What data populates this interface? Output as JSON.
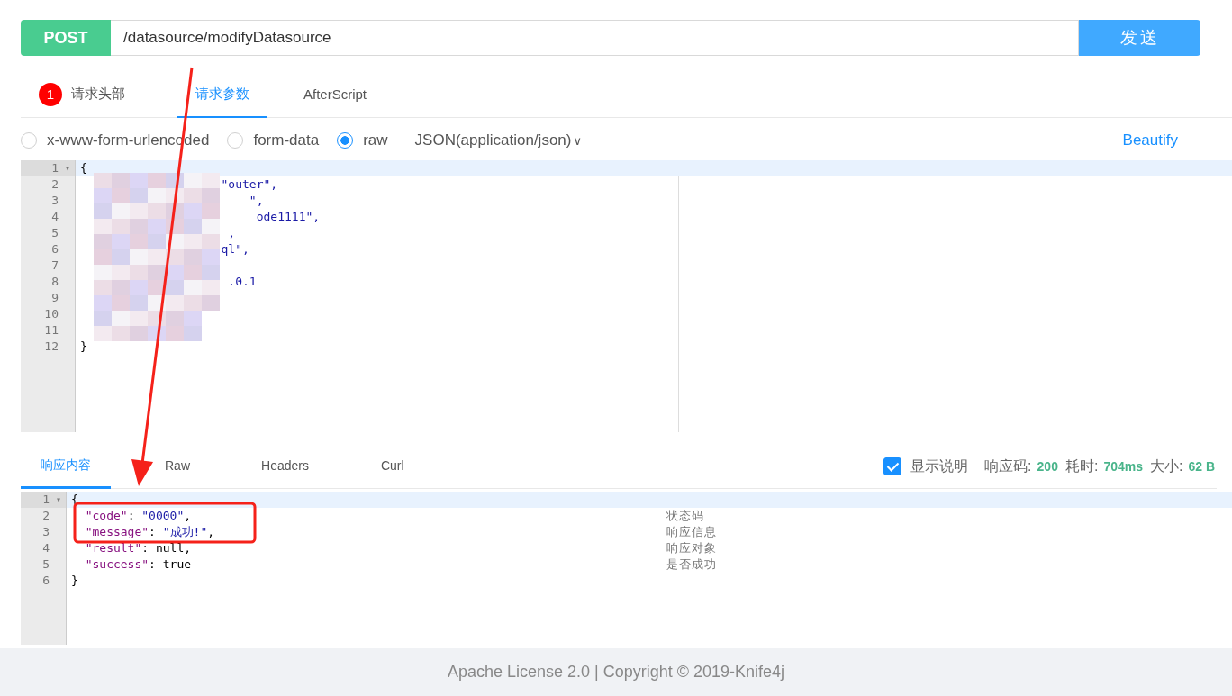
{
  "request": {
    "method": "POST",
    "url": "/datasource/modifyDatasource",
    "send": "发送"
  },
  "tabs": [
    {
      "label": "请求头部",
      "badge": "1",
      "selected": false
    },
    {
      "label": "请求参数",
      "selected": true
    },
    {
      "label": "AfterScript",
      "selected": false
    }
  ],
  "body_types": [
    {
      "label": "x-www-form-urlencoded",
      "selected": false
    },
    {
      "label": "form-data",
      "selected": false
    },
    {
      "label": "raw",
      "selected": true
    }
  ],
  "content_type": "JSON(application/json)",
  "caret": "∨",
  "beautify": "Beautify",
  "request_editor": {
    "lines": [
      {
        "no": "1",
        "text": "{",
        "fold": "▾"
      },
      {
        "no": "2",
        "text": "                    \"outer\","
      },
      {
        "no": "3",
        "text": "                        \","
      },
      {
        "no": "4",
        "text": "                         ode1111\","
      },
      {
        "no": "5",
        "text": "                     ,"
      },
      {
        "no": "6",
        "text": "                    ql\","
      },
      {
        "no": "7"
      },
      {
        "no": "8",
        "text": "                     .0.1"
      },
      {
        "no": "9"
      },
      {
        "no": "10"
      },
      {
        "no": "11"
      },
      {
        "no": "12",
        "text": "}"
      }
    ]
  },
  "response_tabs": [
    {
      "label": "响应内容",
      "selected": true
    },
    {
      "label": "Raw",
      "selected": false
    },
    {
      "label": "Headers",
      "selected": false
    },
    {
      "label": "Curl",
      "selected": false
    }
  ],
  "show_description": {
    "label": "显示说明",
    "checked": true
  },
  "stats": [
    {
      "label": "响应码:",
      "value": "200"
    },
    {
      "label": "耗时:",
      "value": "704ms"
    },
    {
      "label": "大小:",
      "value": "62 B"
    }
  ],
  "response_editor": {
    "lines": [
      {
        "no": "1",
        "fold": "▾",
        "tokens": [
          {
            "kind": "plain",
            "text": "{"
          }
        ]
      },
      {
        "no": "2",
        "tokens": [
          {
            "kind": "key",
            "text": "  \"code\""
          },
          {
            "kind": "plain",
            "text": ": "
          },
          {
            "kind": "string",
            "text": "\"0000\""
          },
          {
            "kind": "plain",
            "text": ","
          }
        ],
        "note": "状态码"
      },
      {
        "no": "3",
        "tokens": [
          {
            "kind": "key",
            "text": "  \"message\""
          },
          {
            "kind": "plain",
            "text": ": "
          },
          {
            "kind": "string",
            "text": "\"成功!\""
          },
          {
            "kind": "plain",
            "text": ","
          }
        ],
        "note": "响应信息"
      },
      {
        "no": "4",
        "tokens": [
          {
            "kind": "key",
            "text": "  \"result\""
          },
          {
            "kind": "plain",
            "text": ": null,"
          }
        ],
        "note": "响应对象"
      },
      {
        "no": "5",
        "tokens": [
          {
            "kind": "key",
            "text": "  \"success\""
          },
          {
            "kind": "plain",
            "text": ": true"
          }
        ],
        "note": "是否成功"
      },
      {
        "no": "6",
        "tokens": [
          {
            "kind": "plain",
            "text": "}"
          }
        ]
      }
    ]
  },
  "footer": "Apache License 2.0 | Copyright © 2019-Knife4j"
}
